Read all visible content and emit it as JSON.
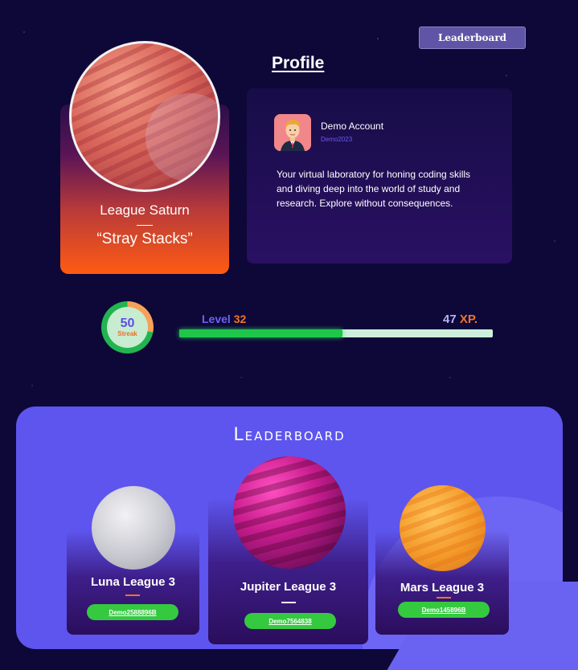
{
  "header": {
    "leaderboard_button": "Leaderboard"
  },
  "league": {
    "name": "League Saturn",
    "motto": "“Stray Stacks”"
  },
  "profile": {
    "title": "Profile",
    "account_name": "Demo Account",
    "handle": "Demo2023",
    "bio": "Your virtual laboratory for honing coding skills and diving deep into the world of study and research. Explore without consequences."
  },
  "stats": {
    "streak_value": "50",
    "streak_label": "Streak",
    "level_word": "Level",
    "level_number": "32",
    "xp_value": "47",
    "xp_unit": "XP.",
    "progress_fraction": 0.52
  },
  "leaderboard": {
    "title": "Leaderboard",
    "entries": [
      {
        "league": "Luna League 3",
        "user": "Demo2588896B",
        "accent": "#f2732b"
      },
      {
        "league": "Jupiter League 3",
        "user": "Demo7564838",
        "accent": "#ffffff"
      },
      {
        "league": "Mars League 3",
        "user": "Demo145896B",
        "accent": "#f2732b"
      }
    ]
  },
  "colors": {
    "background": "#0e0838",
    "panel": "#5d55ee",
    "accent_orange": "#f2732b",
    "accent_purple": "#6e62f4",
    "progress_green": "#1ec64a"
  }
}
